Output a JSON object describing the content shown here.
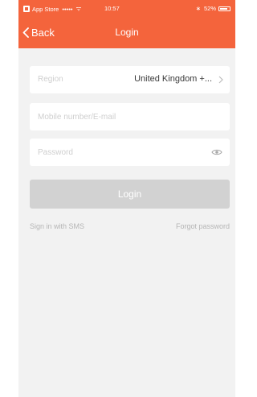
{
  "status_bar": {
    "carrier": "App Store",
    "signal": "•••••",
    "wifi": "ᯤ",
    "time": "10:57",
    "battery_percent": "52%",
    "bluetooth": "∗"
  },
  "nav": {
    "back_label": "Back",
    "title": "Login"
  },
  "form": {
    "region_label": "Region",
    "region_value": "United Kingdom +...",
    "mobile_placeholder": "Mobile number/E-mail",
    "password_placeholder": "Password",
    "login_label": "Login"
  },
  "links": {
    "sms_login": "Sign in with SMS",
    "forgot_password": "Forgot password"
  },
  "colors": {
    "accent": "#f4643c",
    "background": "#f2f2f2",
    "button_disabled": "#d2d2d2"
  }
}
